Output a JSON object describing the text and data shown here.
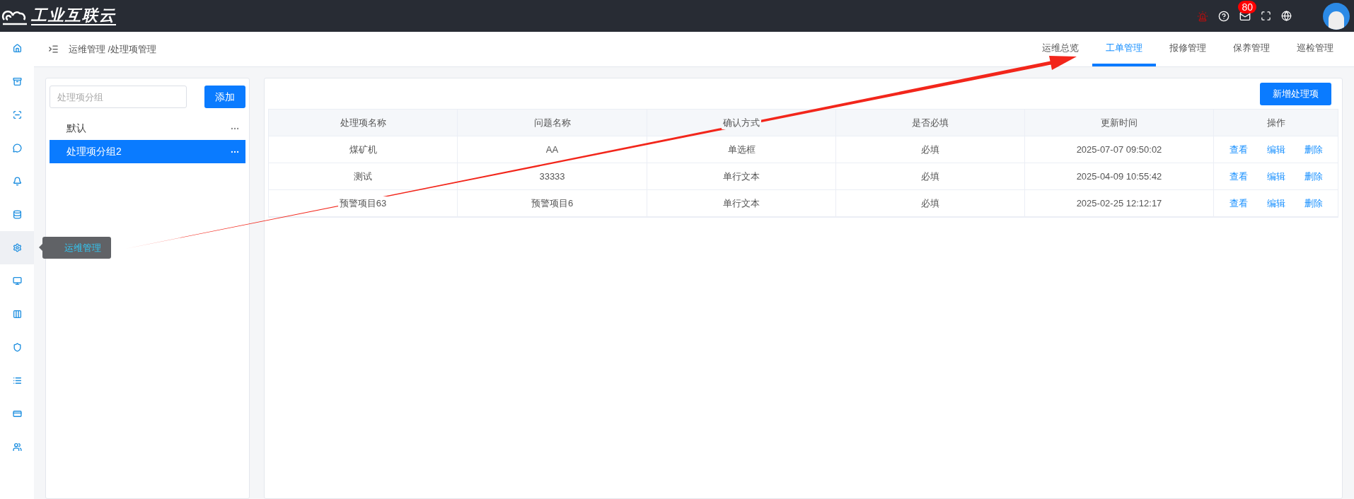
{
  "logo": {
    "text": "工业互联云"
  },
  "header": {
    "mail_badge": "80"
  },
  "sidebar": {
    "items": [
      {
        "kind": "home",
        "selected": false
      },
      {
        "kind": "storage",
        "selected": false
      },
      {
        "kind": "scan",
        "selected": false
      },
      {
        "kind": "chat",
        "selected": false
      },
      {
        "kind": "bell",
        "selected": false
      },
      {
        "kind": "database",
        "selected": false
      },
      {
        "kind": "gear",
        "selected": true
      },
      {
        "kind": "monitor",
        "selected": false
      },
      {
        "kind": "columns",
        "selected": false
      },
      {
        "kind": "shield",
        "selected": false
      },
      {
        "kind": "list",
        "selected": false
      },
      {
        "kind": "card",
        "selected": false
      },
      {
        "kind": "users",
        "selected": false
      }
    ],
    "tooltip": "运维管理"
  },
  "breadcrumb": "运维管理 /处理项管理",
  "tabs": [
    {
      "label": "运维总览",
      "selected": false
    },
    {
      "label": "工单管理",
      "selected": true
    },
    {
      "label": "报修管理",
      "selected": false
    },
    {
      "label": "保养管理",
      "selected": false
    },
    {
      "label": "巡检管理",
      "selected": false
    }
  ],
  "groups": {
    "search": {
      "placeholder": "处理项分组"
    },
    "add_button": "添加",
    "items": [
      {
        "label": "默认",
        "selected": false
      },
      {
        "label": "处理项分组2",
        "selected": true
      }
    ]
  },
  "table": {
    "new_button": "新增处理项",
    "columns": [
      "处理项名称",
      "问题名称",
      "确认方式",
      "是否必填",
      "更新时间",
      "操作"
    ],
    "rows": [
      {
        "cells": [
          "煤矿机",
          "AA",
          "单选框",
          "必填",
          "2025-07-07 09:50:02"
        ],
        "actions": [
          "查看",
          "编辑",
          "删除"
        ]
      },
      {
        "cells": [
          "测试",
          "33333",
          "单行文本",
          "必填",
          "2025-04-09 10:55:42"
        ],
        "actions": [
          "查看",
          "编辑",
          "删除"
        ]
      },
      {
        "cells": [
          "预警项目63",
          "预警项目6",
          "单行文本",
          "必填",
          "2025-02-25 12:12:17"
        ],
        "actions": [
          "查看",
          "编辑",
          "删除"
        ]
      }
    ]
  }
}
